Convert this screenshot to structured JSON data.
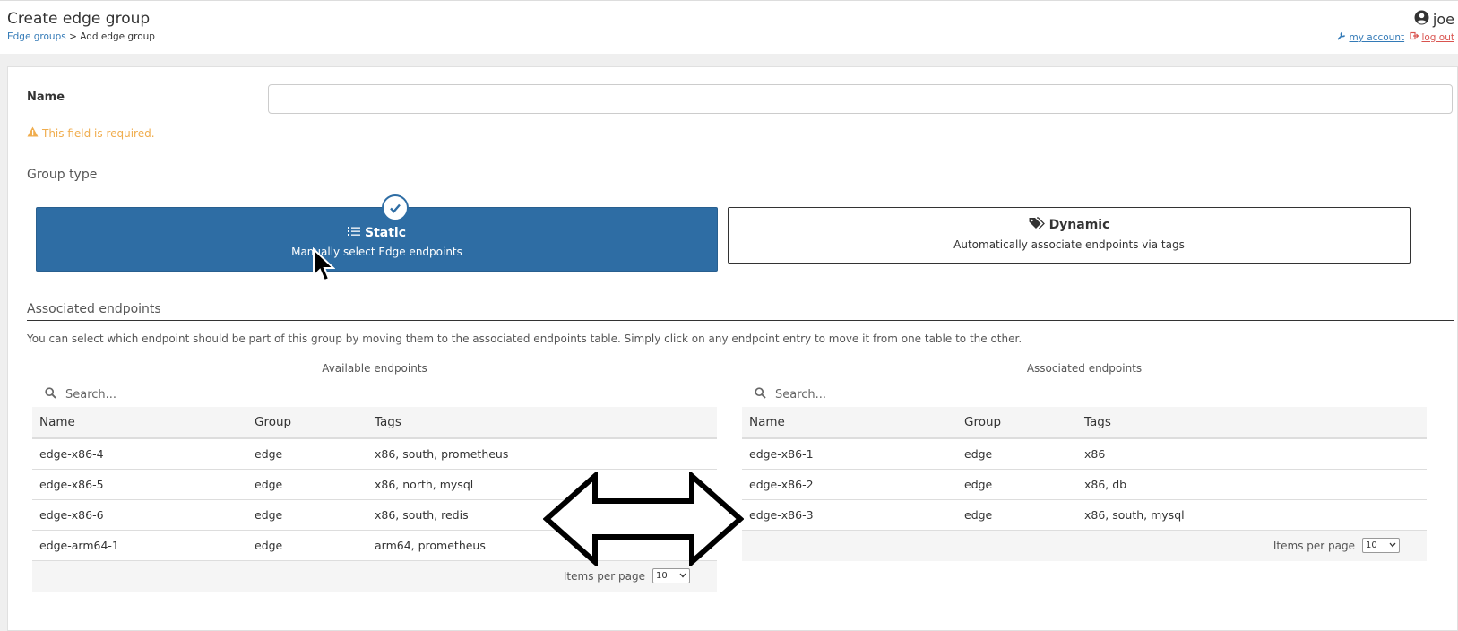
{
  "header": {
    "title": "Create edge group",
    "breadcrumb_link": "Edge groups",
    "breadcrumb_sep": " > ",
    "breadcrumb_current": "Add edge group",
    "username": "joe",
    "my_account": "my account",
    "log_out": "log out"
  },
  "form": {
    "name_label": "Name",
    "name_value": "",
    "required_warning": "This field is required.",
    "group_type_title": "Group type",
    "static": {
      "title": "Static",
      "description": "Manually select Edge endpoints",
      "selected": true
    },
    "dynamic": {
      "title": "Dynamic",
      "description": "Automatically associate endpoints via tags",
      "selected": false
    },
    "associated_title": "Associated endpoints",
    "explanation": "You can select which endpoint should be part of this group by moving them to the associated endpoints table. Simply click on any endpoint entry to move it from one table to the other."
  },
  "available": {
    "caption": "Available endpoints",
    "search_placeholder": "Search...",
    "columns": [
      "Name",
      "Group",
      "Tags"
    ],
    "rows": [
      [
        "edge-x86-4",
        "edge",
        "x86, south, prometheus"
      ],
      [
        "edge-x86-5",
        "edge",
        "x86, north, mysql"
      ],
      [
        "edge-x86-6",
        "edge",
        "x86, south, redis"
      ],
      [
        "edge-arm64-1",
        "edge",
        "arm64, prometheus"
      ]
    ],
    "items_per_page_label": "Items per page",
    "items_per_page": "10"
  },
  "associated": {
    "caption": "Associated endpoints",
    "search_placeholder": "Search...",
    "columns": [
      "Name",
      "Group",
      "Tags"
    ],
    "rows": [
      [
        "edge-x86-1",
        "edge",
        "x86"
      ],
      [
        "edge-x86-2",
        "edge",
        "x86, db"
      ],
      [
        "edge-x86-3",
        "edge",
        "x86, south, mysql"
      ]
    ],
    "items_per_page_label": "Items per page",
    "items_per_page": "10"
  },
  "colors": {
    "primary": "#2e6da4",
    "warning": "#f0ad4e",
    "link": "#337ab7",
    "danger": "#d9534f"
  },
  "icons": [
    "user-circle-icon",
    "wrench-icon",
    "sign-out-icon",
    "warning-icon",
    "check-circle-icon",
    "list-icon",
    "tags-icon",
    "search-icon",
    "double-arrow-icon",
    "mouse-cursor-icon"
  ]
}
